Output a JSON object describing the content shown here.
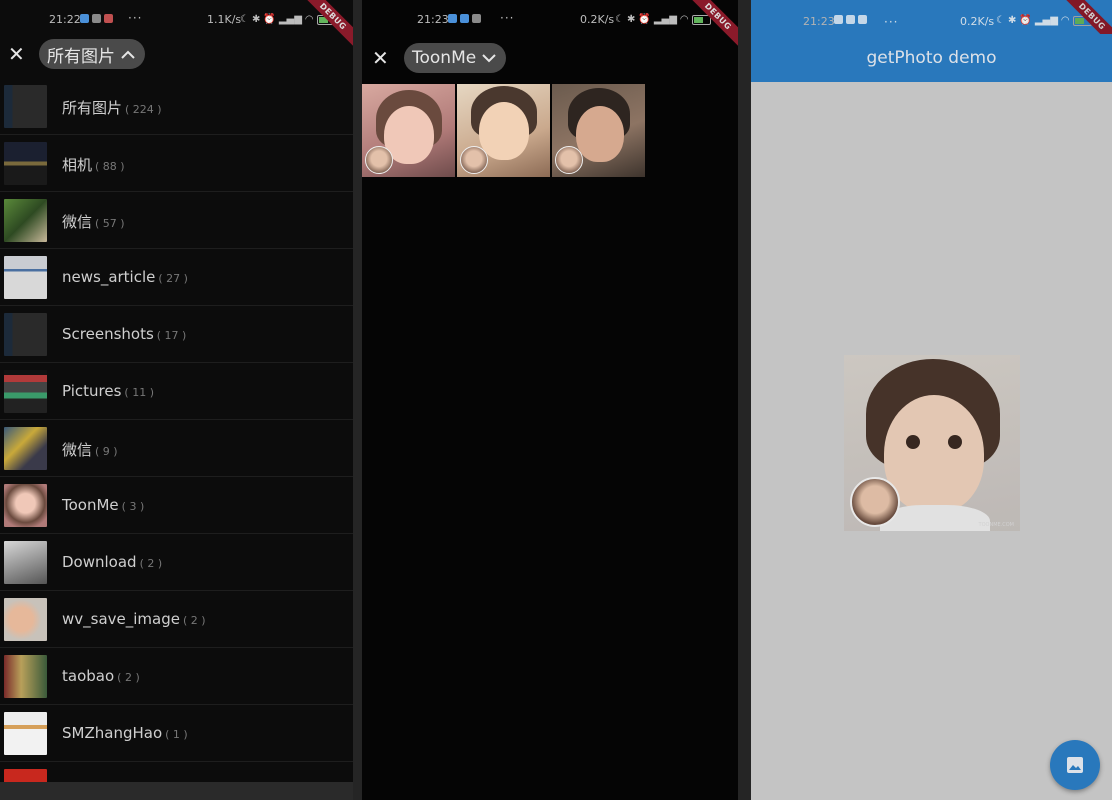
{
  "left": {
    "status": {
      "time": "21:22",
      "net": "1.1K/s",
      "dots": "···"
    },
    "debug": "DEBUG",
    "close_icon": "close-icon",
    "album_selector": {
      "label": "所有图片",
      "icon": "chevron-up-icon"
    },
    "albums": [
      {
        "name": "所有图片",
        "count": "( 224 )",
        "thumb": "screenshot"
      },
      {
        "name": "相机",
        "count": "( 88 )",
        "thumb": "night"
      },
      {
        "name": "微信",
        "count": "( 57 )",
        "thumb": "green"
      },
      {
        "name": "news_article",
        "count": "( 27 )",
        "thumb": "doc"
      },
      {
        "name": "Screenshots",
        "count": "( 17 )",
        "thumb": "screenshot"
      },
      {
        "name": "Pictures",
        "count": "( 11 )",
        "thumb": "bars"
      },
      {
        "name": "微信",
        "count": "( 9 )",
        "thumb": "crowd"
      },
      {
        "name": "ToonMe",
        "count": "( 3 )",
        "thumb": "toon"
      },
      {
        "name": "Download",
        "count": "( 2 )",
        "thumb": "box"
      },
      {
        "name": "wv_save_image",
        "count": "( 2 )",
        "thumb": "hand"
      },
      {
        "name": "taobao",
        "count": "( 2 )",
        "thumb": "shop"
      },
      {
        "name": "SMZhangHao",
        "count": "( 1 )",
        "thumb": "card"
      },
      {
        "name": "",
        "count": "",
        "thumb": "flag"
      }
    ]
  },
  "middle": {
    "status": {
      "time": "21:23",
      "net": "0.2K/s",
      "dots": "···"
    },
    "debug": "DEBUG",
    "close_icon": "close-icon",
    "album_selector": {
      "label": "ToonMe",
      "icon": "chevron-down-icon"
    },
    "photos_count": 3
  },
  "right": {
    "status": {
      "time": "21:23",
      "net": "0.2K/s",
      "dots": "···"
    },
    "debug": "DEBUG",
    "app_title": "getPhoto demo",
    "watermark": "TOONME.COM",
    "fab_icon": "image-icon",
    "accent": "#2c7fc7"
  }
}
